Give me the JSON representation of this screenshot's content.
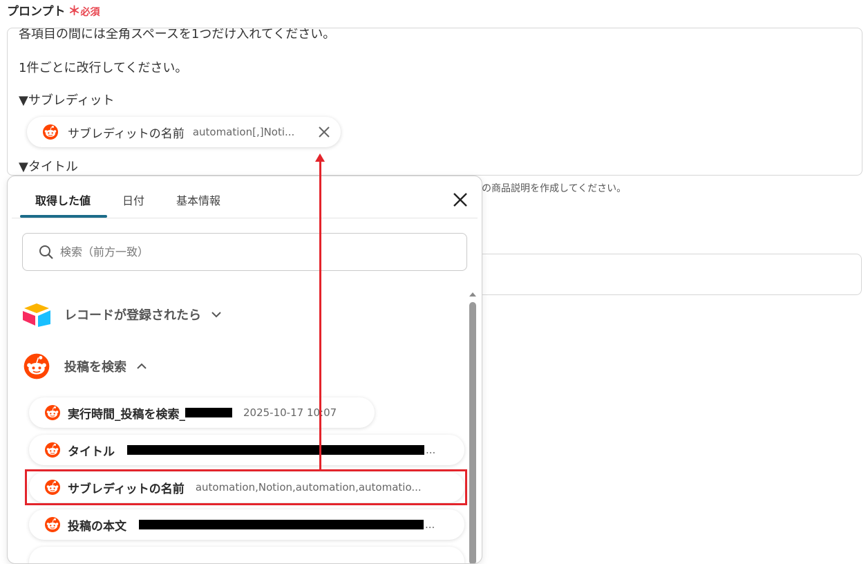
{
  "field": {
    "label": "プロンプト",
    "required_mark": "＊",
    "required_text": "必須"
  },
  "prompt": {
    "lines": [
      "各項目の間には全角スペースを1つだけ入れてください。",
      "1件ごとに改行してください。",
      "▼サブレディット",
      "▼タイトル"
    ],
    "chip": {
      "label": "サブレディットの名前",
      "value": "automation[,]Noti..."
    }
  },
  "hint": "の商品説明を作成してください。",
  "dropdown": {
    "tabs": [
      {
        "label": "取得した値"
      },
      {
        "label": "日付"
      },
      {
        "label": "基本情報"
      }
    ],
    "search_placeholder": "検索（前方一致）",
    "sections": [
      {
        "label": "レコードが登録されたら",
        "icon": "airtable-icon"
      },
      {
        "label": "投稿を検索",
        "icon": "reddit-icon"
      }
    ],
    "items": [
      {
        "label": "実行時間_投稿を検索_",
        "value": "2025-10-17 10:07"
      },
      {
        "label": "タイトル",
        "value": "..."
      },
      {
        "label": "サブレディットの名前",
        "value": "automation,Notion,automation,automatio..."
      },
      {
        "label": "投稿の本文",
        "value": "..."
      }
    ]
  },
  "colors": {
    "accent": "#1c6c8a",
    "required": "#e8454f",
    "highlight": "#e3242b",
    "reddit": "#ff4500"
  }
}
